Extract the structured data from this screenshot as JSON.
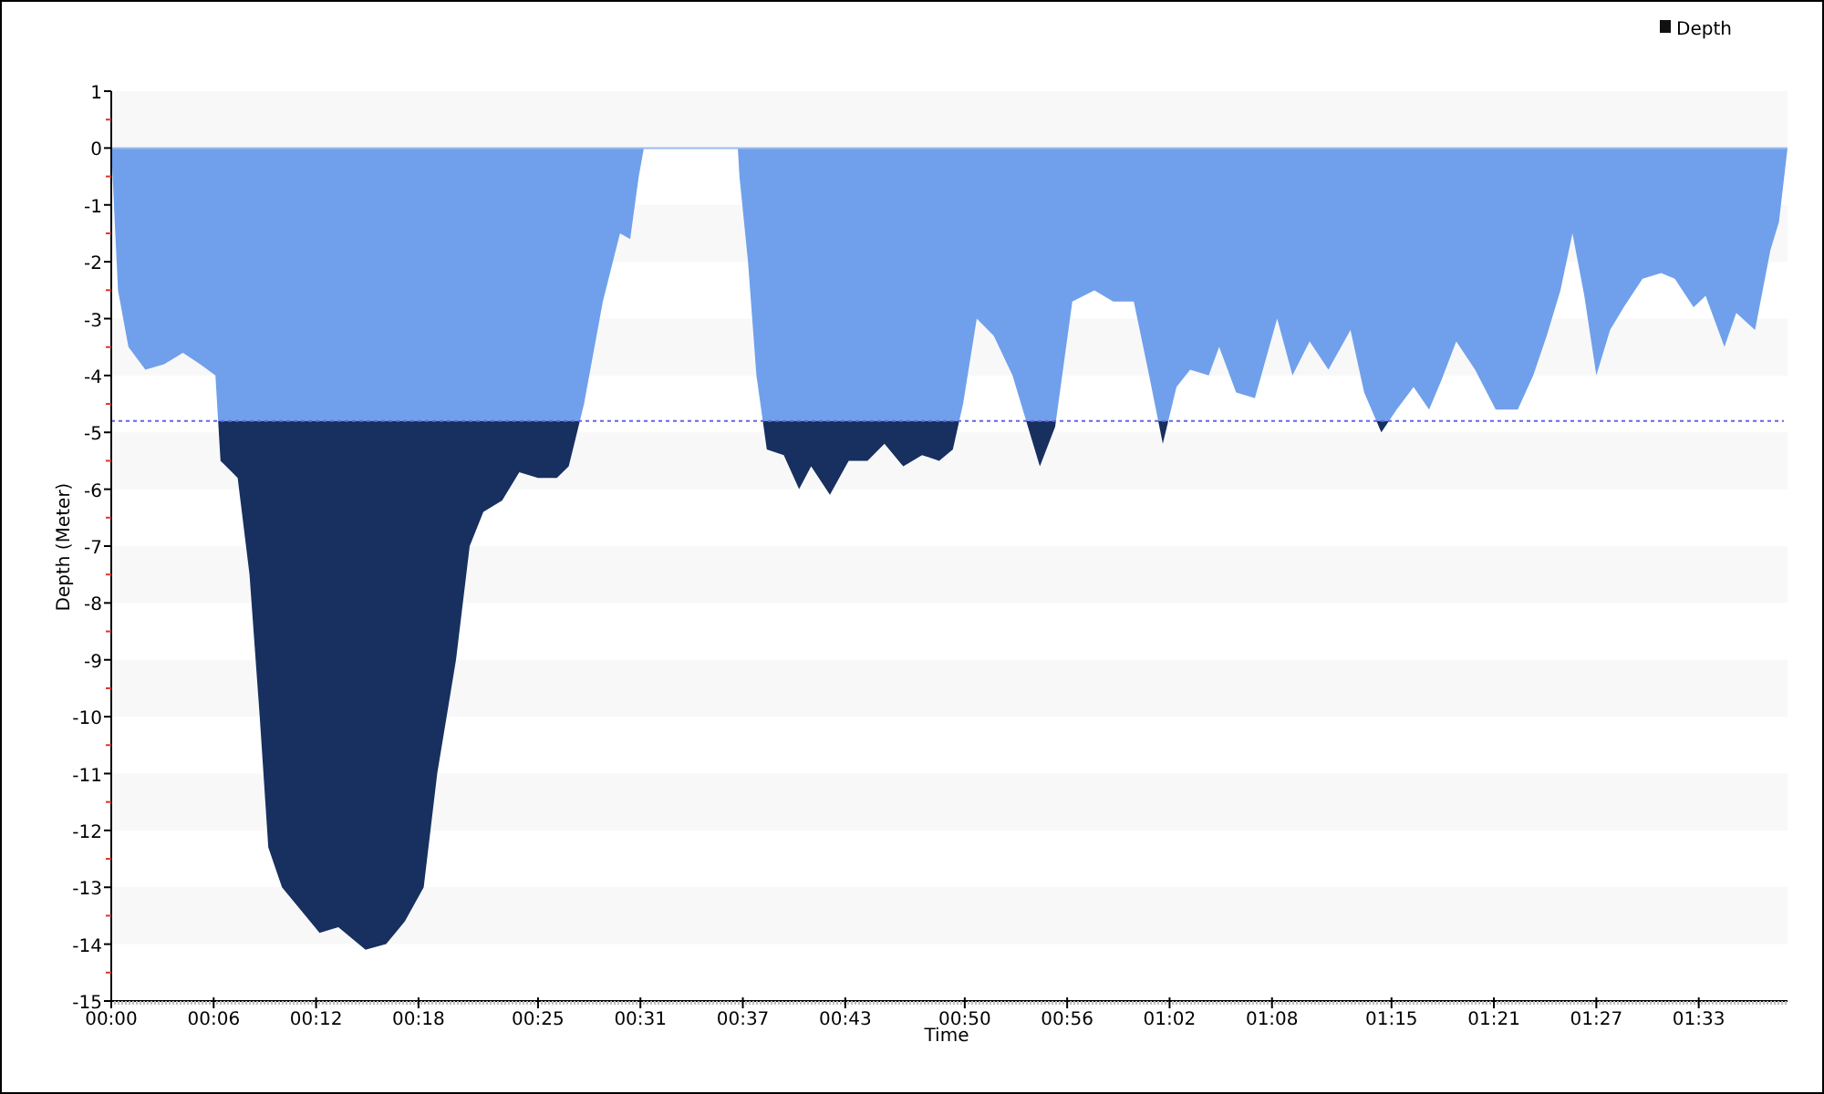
{
  "chart_data": {
    "type": "area",
    "xlabel": "Time",
    "ylabel": "Depth (Meter)",
    "series": [
      {
        "name": "Depth",
        "x": [
          0,
          0.4,
          1.0,
          2.0,
          3.1,
          4.2,
          5.2,
          6.1,
          6.4,
          7.4,
          8.1,
          8.7,
          9.2,
          10.0,
          11.1,
          12.2,
          13.3,
          14.9,
          16.1,
          17.2,
          18.3,
          19.1,
          20.2,
          21.0,
          21.8,
          22.9,
          23.9,
          25.0,
          26.1,
          26.8,
          27.7,
          28.8,
          29.8,
          30.4,
          30.9,
          31.2,
          36.7,
          36.8,
          37.3,
          37.8,
          38.4,
          39.4,
          40.3,
          41.0,
          42.1,
          43.2,
          44.3,
          45.3,
          46.4,
          47.5,
          48.5,
          49.3,
          49.9,
          50.7,
          51.7,
          52.8,
          53.6,
          54.4,
          55.3,
          56.3,
          57.6,
          58.7,
          59.9,
          60.8,
          61.6,
          62.4,
          63.2,
          64.3,
          64.9,
          65.9,
          67.0,
          68.3,
          69.2,
          70.2,
          71.3,
          72.6,
          73.4,
          74.4,
          75.3,
          76.3,
          77.2,
          77.9,
          78.8,
          79.9,
          81.1,
          82.4,
          83.3,
          84.1,
          84.9,
          85.6,
          86.3,
          87.0,
          87.8,
          88.6,
          89.7,
          90.8,
          91.6,
          92.7,
          93.4,
          94.5,
          95.2,
          96.3,
          97.2,
          97.7,
          98.2
        ],
        "values": [
          0,
          -2.5,
          -3.5,
          -3.9,
          -3.8,
          -3.6,
          -3.8,
          -4.0,
          -5.5,
          -5.8,
          -7.5,
          -10,
          -12.3,
          -13,
          -13.4,
          -13.8,
          -13.7,
          -14.1,
          -14.0,
          -13.6,
          -13,
          -11,
          -9,
          -7,
          -6.4,
          -6.2,
          -5.7,
          -5.8,
          -5.8,
          -5.6,
          -4.5,
          -2.7,
          -1.5,
          -1.6,
          -0.5,
          0,
          0,
          -0.5,
          -2,
          -4,
          -5.3,
          -5.4,
          -6,
          -5.6,
          -6.1,
          -5.5,
          -5.5,
          -5.2,
          -5.6,
          -5.4,
          -5.5,
          -5.3,
          -4.5,
          -3.0,
          -3.3,
          -4.0,
          -4.8,
          -5.6,
          -4.9,
          -2.7,
          -2.5,
          -2.7,
          -2.7,
          -4.0,
          -5.2,
          -4.2,
          -3.9,
          -4.0,
          -3.5,
          -4.3,
          -4.4,
          -3.0,
          -4.0,
          -3.4,
          -3.9,
          -3.2,
          -4.3,
          -5.0,
          -4.6,
          -4.2,
          -4.6,
          -4.1,
          -3.4,
          -3.9,
          -4.6,
          -4.6,
          -4.0,
          -3.3,
          -2.5,
          -1.5,
          -2.6,
          -4.0,
          -3.2,
          -2.8,
          -2.3,
          -2.2,
          -2.3,
          -2.8,
          -2.6,
          -3.5,
          -2.9,
          -3.2,
          -1.8,
          -1.3,
          0
        ]
      }
    ],
    "xlim": [
      0,
      98.2
    ],
    "ylim": [
      -15,
      1
    ],
    "xticks": [
      {
        "value": 0,
        "label": "00:00"
      },
      {
        "value": 6,
        "label": "00:06"
      },
      {
        "value": 12,
        "label": "00:12"
      },
      {
        "value": 18,
        "label": "00:18"
      },
      {
        "value": 25,
        "label": "00:25"
      },
      {
        "value": 31,
        "label": "00:31"
      },
      {
        "value": 37,
        "label": "00:37"
      },
      {
        "value": 43,
        "label": "00:43"
      },
      {
        "value": 50,
        "label": "00:50"
      },
      {
        "value": 56,
        "label": "00:56"
      },
      {
        "value": 62,
        "label": "01:02"
      },
      {
        "value": 68,
        "label": "01:08"
      },
      {
        "value": 75,
        "label": "01:15"
      },
      {
        "value": 81,
        "label": "01:21"
      },
      {
        "value": 87,
        "label": "01:27"
      },
      {
        "value": 93,
        "label": "01:33"
      }
    ],
    "yticks": [
      1,
      0,
      -1,
      -2,
      -3,
      -4,
      -5,
      -6,
      -7,
      -8,
      -9,
      -10,
      -11,
      -12,
      -13,
      -14,
      -15
    ],
    "ref_lines": [
      {
        "axis": "y",
        "value": -4.8
      }
    ]
  }
}
